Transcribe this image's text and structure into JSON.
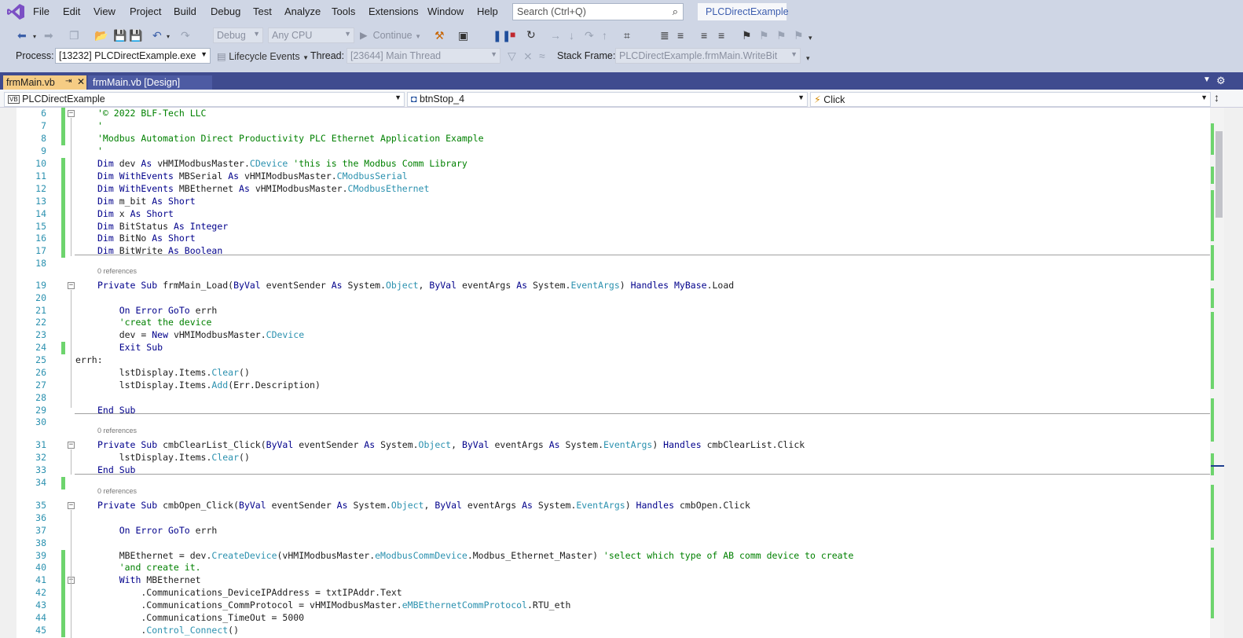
{
  "menu": [
    "File",
    "Edit",
    "View",
    "Project",
    "Build",
    "Debug",
    "Test",
    "Analyze",
    "Tools",
    "Extensions",
    "Window",
    "Help"
  ],
  "search": {
    "placeholder": "Search (Ctrl+Q)"
  },
  "solution_name": "PLCDirectExample",
  "toolbar": {
    "config": "Debug",
    "platform": "Any CPU",
    "continue_label": "Continue"
  },
  "debug_bar": {
    "process_label": "Process:",
    "process_value": "[13232] PLCDirectExample.exe",
    "lifecycle_label": "Lifecycle Events",
    "thread_label": "Thread:",
    "thread_value": "[23644] Main Thread",
    "stackframe_label": "Stack Frame:",
    "stackframe_value": "PLCDirectExample.frmMain.WriteBit"
  },
  "tabs": [
    {
      "label": "frmMain.vb",
      "active": true
    },
    {
      "label": "frmMain.vb [Design]",
      "active": false
    }
  ],
  "navbar": {
    "project": "PLCDirectExample",
    "project_badge": "VB",
    "object": "btnStop_4",
    "member": "Click"
  },
  "references_label": "0 references",
  "code_lines": [
    {
      "n": 6,
      "t": [
        [
          "c",
          "'© 2022 BLF-Tech LLC"
        ]
      ]
    },
    {
      "n": 7,
      "t": [
        [
          "c",
          "'"
        ]
      ]
    },
    {
      "n": 8,
      "t": [
        [
          "c",
          "'Modbus Automation Direct Productivity PLC Ethernet Application Example"
        ]
      ]
    },
    {
      "n": 9,
      "t": [
        [
          "c",
          "'"
        ]
      ]
    },
    {
      "n": 10,
      "t": [
        [
          "k2",
          "Dim"
        ],
        [
          "p",
          " dev "
        ],
        [
          "k2",
          "As"
        ],
        [
          "p",
          " vHMIModbusMaster."
        ],
        [
          "ty",
          "CDevice"
        ],
        [
          "c",
          " 'this is the Modbus Comm Library"
        ]
      ]
    },
    {
      "n": 11,
      "t": [
        [
          "k2",
          "Dim WithEvents"
        ],
        [
          "p",
          " MBSerial "
        ],
        [
          "k2",
          "As"
        ],
        [
          "p",
          " vHMIModbusMaster."
        ],
        [
          "ty",
          "CModbusSerial"
        ]
      ]
    },
    {
      "n": 12,
      "t": [
        [
          "k2",
          "Dim WithEvents"
        ],
        [
          "p",
          " MBEthernet "
        ],
        [
          "k2",
          "As"
        ],
        [
          "p",
          " vHMIModbusMaster."
        ],
        [
          "ty",
          "CModbusEthernet"
        ]
      ]
    },
    {
      "n": 13,
      "t": [
        [
          "k2",
          "Dim"
        ],
        [
          "p",
          " m_bit "
        ],
        [
          "k2",
          "As Short"
        ]
      ]
    },
    {
      "n": 14,
      "t": [
        [
          "k2",
          "Dim"
        ],
        [
          "p",
          " x "
        ],
        [
          "k2",
          "As Short"
        ]
      ]
    },
    {
      "n": 15,
      "t": [
        [
          "k2",
          "Dim"
        ],
        [
          "p",
          " BitStatus "
        ],
        [
          "k2",
          "As Integer"
        ]
      ]
    },
    {
      "n": 16,
      "t": [
        [
          "k2",
          "Dim"
        ],
        [
          "p",
          " BitNo "
        ],
        [
          "k2",
          "As Short"
        ]
      ]
    },
    {
      "n": 17,
      "t": [
        [
          "k2",
          "Dim"
        ],
        [
          "p",
          " BitWrite "
        ],
        [
          "k2",
          "As Boolean"
        ]
      ]
    },
    {
      "n": 18,
      "t": []
    },
    {
      "n": 19,
      "t": [
        [
          "k2",
          "Private Sub"
        ],
        [
          "p",
          " frmMain_Load("
        ],
        [
          "k2",
          "ByVal"
        ],
        [
          "p",
          " eventSender "
        ],
        [
          "k2",
          "As"
        ],
        [
          "p",
          " System."
        ],
        [
          "ty",
          "Object"
        ],
        [
          "p",
          ", "
        ],
        [
          "k2",
          "ByVal"
        ],
        [
          "p",
          " eventArgs "
        ],
        [
          "k2",
          "As"
        ],
        [
          "p",
          " System."
        ],
        [
          "ty",
          "EventArgs"
        ],
        [
          "p",
          ") "
        ],
        [
          "k2",
          "Handles MyBase"
        ],
        [
          "p",
          ".Load"
        ]
      ]
    },
    {
      "n": 20,
      "t": []
    },
    {
      "n": 21,
      "t": [
        [
          "k2",
          "    On Error GoTo"
        ],
        [
          "p",
          " errh"
        ]
      ]
    },
    {
      "n": 22,
      "t": [
        [
          "c",
          "    'creat the device"
        ]
      ]
    },
    {
      "n": 23,
      "t": [
        [
          "p",
          "    dev = "
        ],
        [
          "k2",
          "New"
        ],
        [
          "p",
          " vHMIModbusMaster."
        ],
        [
          "ty",
          "CDevice"
        ]
      ]
    },
    {
      "n": 24,
      "t": [
        [
          "k2",
          "    Exit Sub"
        ]
      ]
    },
    {
      "n": 25,
      "t": [
        [
          "p",
          "errh:"
        ]
      ]
    },
    {
      "n": 26,
      "t": [
        [
          "p",
          "    lstDisplay.Items."
        ],
        [
          "ty",
          "Clear"
        ],
        [
          "p",
          "()"
        ]
      ]
    },
    {
      "n": 27,
      "t": [
        [
          "p",
          "    lstDisplay.Items."
        ],
        [
          "ty",
          "Add"
        ],
        [
          "p",
          "(Err.Description)"
        ]
      ]
    },
    {
      "n": 28,
      "t": []
    },
    {
      "n": 29,
      "t": [
        [
          "k2",
          "End Sub"
        ]
      ]
    },
    {
      "n": 30,
      "t": []
    },
    {
      "n": 31,
      "t": [
        [
          "k2",
          "Private Sub"
        ],
        [
          "p",
          " cmbClearList_Click("
        ],
        [
          "k2",
          "ByVal"
        ],
        [
          "p",
          " eventSender "
        ],
        [
          "k2",
          "As"
        ],
        [
          "p",
          " System."
        ],
        [
          "ty",
          "Object"
        ],
        [
          "p",
          ", "
        ],
        [
          "k2",
          "ByVal"
        ],
        [
          "p",
          " eventArgs "
        ],
        [
          "k2",
          "As"
        ],
        [
          "p",
          " System."
        ],
        [
          "ty",
          "EventArgs"
        ],
        [
          "p",
          ") "
        ],
        [
          "k2",
          "Handles"
        ],
        [
          "p",
          " cmbClearList.Click"
        ]
      ]
    },
    {
      "n": 32,
      "t": [
        [
          "p",
          "    lstDisplay.Items."
        ],
        [
          "ty",
          "Clear"
        ],
        [
          "p",
          "()"
        ]
      ]
    },
    {
      "n": 33,
      "t": [
        [
          "k2",
          "End Sub"
        ]
      ]
    },
    {
      "n": 34,
      "t": []
    },
    {
      "n": 35,
      "t": [
        [
          "k2",
          "Private Sub"
        ],
        [
          "p",
          " cmbOpen_Click("
        ],
        [
          "k2",
          "ByVal"
        ],
        [
          "p",
          " eventSender "
        ],
        [
          "k2",
          "As"
        ],
        [
          "p",
          " System."
        ],
        [
          "ty",
          "Object"
        ],
        [
          "p",
          ", "
        ],
        [
          "k2",
          "ByVal"
        ],
        [
          "p",
          " eventArgs "
        ],
        [
          "k2",
          "As"
        ],
        [
          "p",
          " System."
        ],
        [
          "ty",
          "EventArgs"
        ],
        [
          "p",
          ") "
        ],
        [
          "k2",
          "Handles"
        ],
        [
          "p",
          " cmbOpen.Click"
        ]
      ]
    },
    {
      "n": 36,
      "t": []
    },
    {
      "n": 37,
      "t": [
        [
          "k2",
          "    On Error GoTo"
        ],
        [
          "p",
          " errh"
        ]
      ]
    },
    {
      "n": 38,
      "t": []
    },
    {
      "n": 39,
      "t": [
        [
          "p",
          "    MBEthernet = dev."
        ],
        [
          "ty",
          "CreateDevice"
        ],
        [
          "p",
          "(vHMIModbusMaster."
        ],
        [
          "ty",
          "eModbusCommDevice"
        ],
        [
          "p",
          ".Modbus_Ethernet_Master)"
        ],
        [
          "c",
          " 'select which type of AB comm device to create"
        ]
      ]
    },
    {
      "n": 40,
      "t": [
        [
          "c",
          "    'and create it."
        ]
      ]
    },
    {
      "n": 41,
      "t": [
        [
          "k2",
          "    With"
        ],
        [
          "p",
          " MBEthernet"
        ]
      ]
    },
    {
      "n": 42,
      "t": [
        [
          "p",
          "        .Communications_DeviceIPAddress = txtIPAddr.Text"
        ]
      ]
    },
    {
      "n": 43,
      "t": [
        [
          "p",
          "        .Communications_CommProtocol = vHMIModbusMaster."
        ],
        [
          "ty",
          "eMBEthernetCommProtocol"
        ],
        [
          "p",
          ".RTU_eth"
        ]
      ]
    },
    {
      "n": 44,
      "t": [
        [
          "p",
          "        .Communications_TimeOut = 5000"
        ]
      ]
    },
    {
      "n": 45,
      "t": [
        [
          "p",
          "        ."
        ],
        [
          "ty",
          "Control_Connect"
        ],
        [
          "p",
          "()"
        ]
      ]
    }
  ]
}
